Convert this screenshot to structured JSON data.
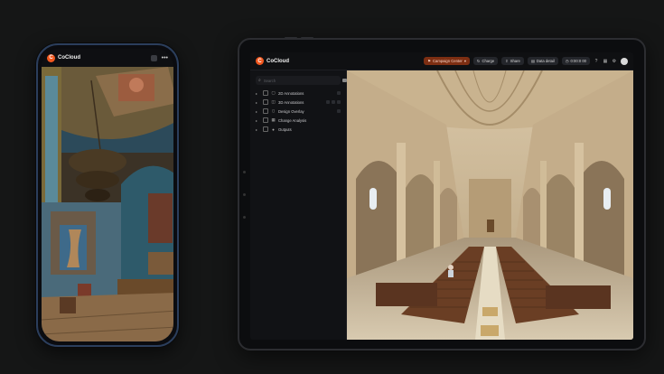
{
  "brand": {
    "name": "CoCloud",
    "mark": "C"
  },
  "phone": {
    "logo_label": "CoCloud",
    "icons": [
      "layers-icon",
      "more-icon"
    ]
  },
  "tablet": {
    "topbar": {
      "campaign": "Campaign Center",
      "charge": "Charge",
      "share": "Share",
      "data_detail": "Data detail",
      "timer": "0:00:0 00"
    },
    "sidebar": {
      "search_placeholder": "Search",
      "items": [
        {
          "label": "2D Annotations"
        },
        {
          "label": "3D Annotations"
        },
        {
          "label": "Design Overlay"
        },
        {
          "label": "Change Analysis"
        },
        {
          "label": "Outputs"
        }
      ]
    }
  },
  "colors": {
    "accent": "#f2581f",
    "phone_frame": "#2b3e5c",
    "background": "#151616"
  }
}
